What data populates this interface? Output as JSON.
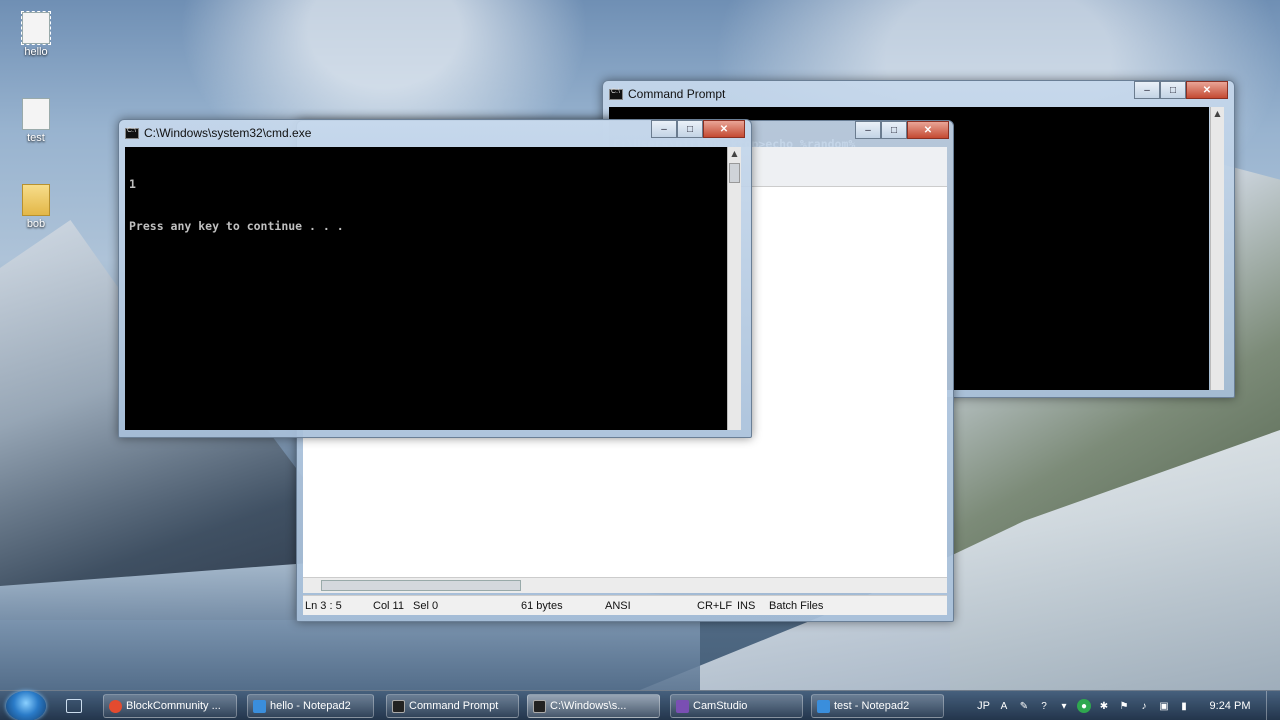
{
  "desktop": {
    "icons": [
      {
        "label": "hello"
      },
      {
        "label": "test"
      },
      {
        "label": "bob"
      }
    ]
  },
  "cmd_back": {
    "title": "Command Prompt",
    "lines": [
      "C:\\Users\\pitt\\Desktop>echo %random%"
    ]
  },
  "cmd_front": {
    "title": "C:\\Windows\\system32\\cmd.exe",
    "lines": [
      "1",
      "Press any key to continue . . ."
    ]
  },
  "notepad": {
    "status": {
      "position": "Ln 3 : 5",
      "col": "Col 11",
      "sel": "Sel 0",
      "size": "61 bytes",
      "encoding": "ANSI",
      "eol": "CR+LF",
      "mode": "INS",
      "scheme": "Batch Files"
    }
  },
  "caption": {
    "minimize": "–",
    "maximize": "□",
    "close": "✕"
  },
  "taskbar": {
    "buttons": [
      {
        "label": "BlockCommunity ...",
        "color": "#e34b2f"
      },
      {
        "label": "hello - Notepad2",
        "color": "#3a8edc"
      },
      {
        "label": "Command Prompt",
        "color": "#222222"
      },
      {
        "label": "C:\\Windows\\s...",
        "color": "#222222"
      },
      {
        "label": "CamStudio",
        "color": "#7a4fb3"
      },
      {
        "label": "test - Notepad2",
        "color": "#3a8edc"
      }
    ],
    "tray": {
      "lang": "JP",
      "time": "9:24 PM"
    }
  }
}
